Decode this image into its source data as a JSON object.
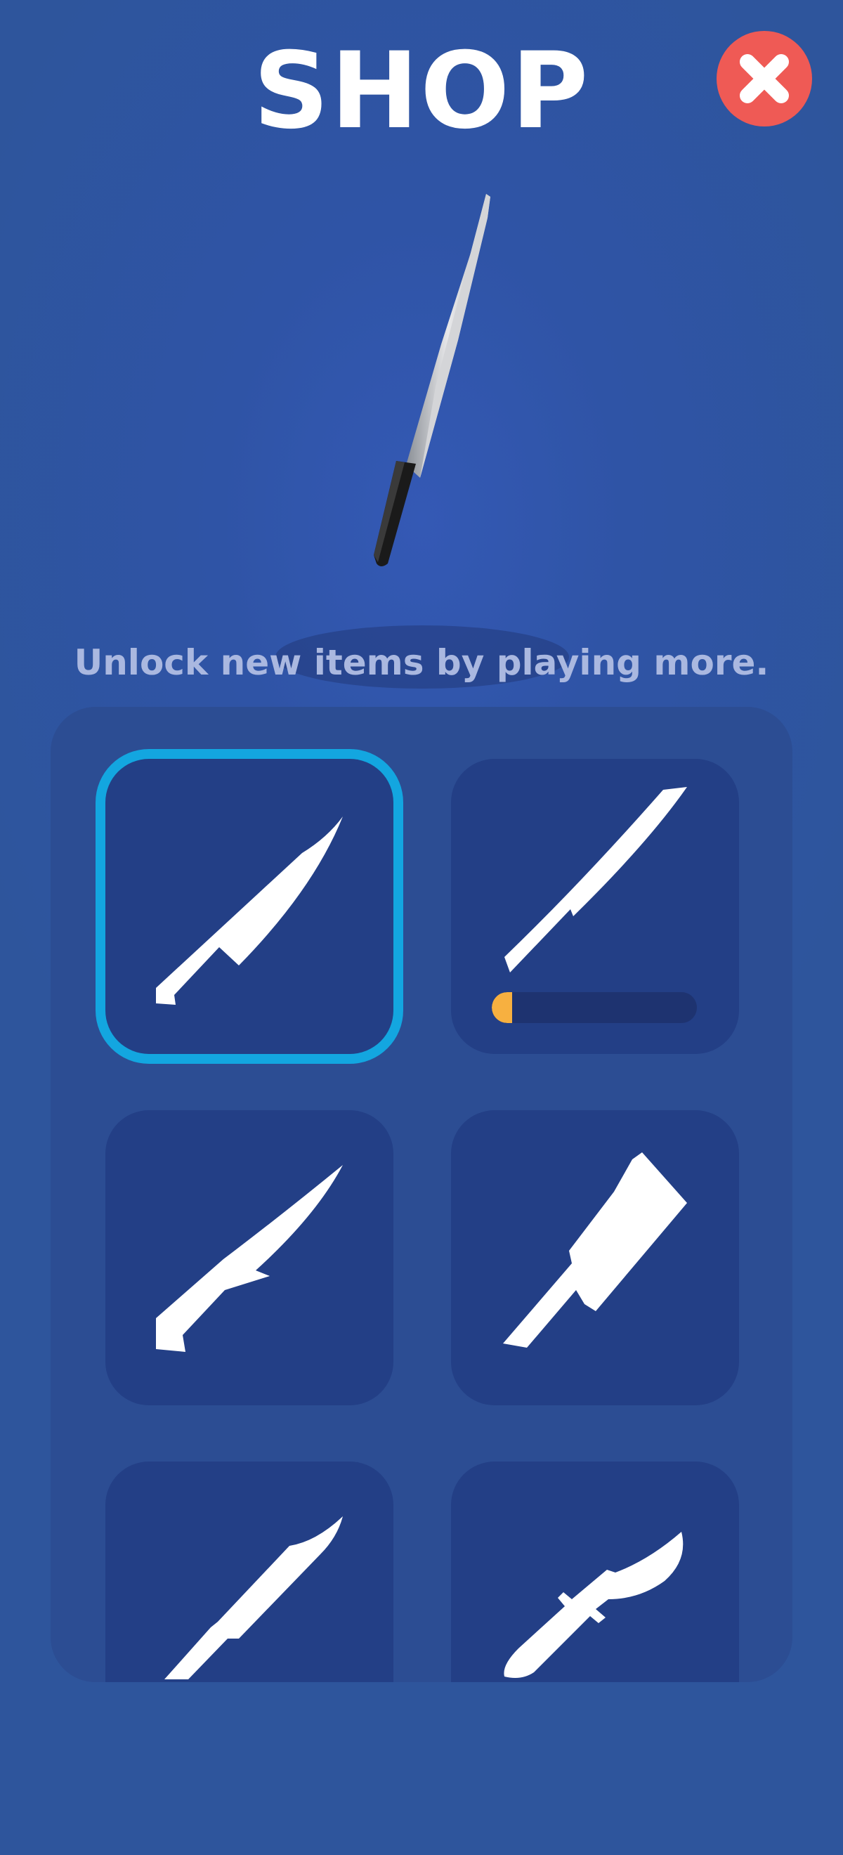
{
  "header": {
    "title": "SHOP"
  },
  "close_button": {
    "icon": "close-icon",
    "color": "#ef5a55"
  },
  "hint": "Unlock new items by playing more.",
  "colors": {
    "background": "#2f54a6",
    "panel": "#2c4d93",
    "slot": "#233f86",
    "selected_outline": "#13a6e0",
    "progress_fill": "#f7b040",
    "progress_track": "#1e3370"
  },
  "items": [
    {
      "icon": "chef-knife-icon",
      "selected": true
    },
    {
      "icon": "long-slicing-knife-icon",
      "selected": false,
      "unlock_progress": 0.1
    },
    {
      "icon": "boning-knife-icon",
      "selected": false
    },
    {
      "icon": "cleaver-icon",
      "selected": false
    },
    {
      "icon": "fillet-knife-icon",
      "selected": false
    },
    {
      "icon": "hunting-knife-icon",
      "selected": false
    }
  ]
}
